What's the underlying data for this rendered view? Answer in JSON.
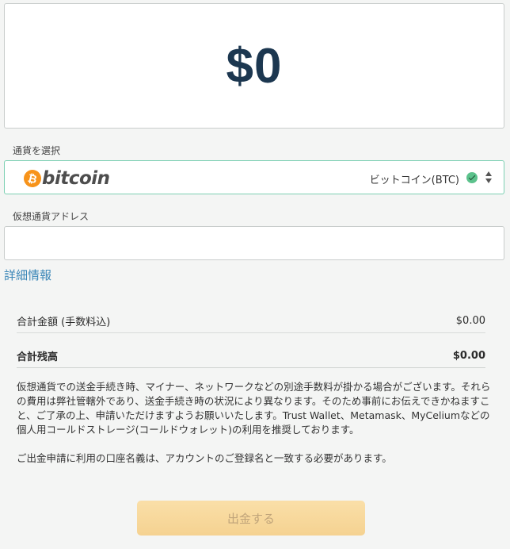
{
  "amount": {
    "value": "$0"
  },
  "currency": {
    "label": "通貨を選択",
    "logo_symbol": "₿",
    "logo_text": "bitcoin",
    "selected_name": "ビットコイン(BTC)"
  },
  "address": {
    "label": "仮想通貨アドレス",
    "value": ""
  },
  "details_link": "詳細情報",
  "summary": {
    "total_fee_label": "合計金額 (手数料込)",
    "total_fee_value": "$0.00",
    "balance_label": "合計残高",
    "balance_value": "$0.00"
  },
  "notice": {
    "paragraph1": "仮想通貨での送金手続き時、マイナー、ネットワークなどの別途手数料が掛かる場合がございます。それらの費用は弊社管轄外であり、送金手続き時の状況により異なります。そのため事前にお伝えできかねますこと、ご了承の上、申請いただけますようお願いいたします。Trust Wallet、Metamask、MyCeliumなどの個人用コールドストレージ(コールドウォレット)の利用を推奨しております。",
    "paragraph2": "ご出金申請に利用の口座名義は、アカウントのご登録名と一致する必要があります。"
  },
  "withdraw_button": "出金する",
  "colors": {
    "amount_text": "#1c3750",
    "select_border": "#7dd0b3",
    "link": "#3a86b7",
    "bitcoin_orange": "#f7931a",
    "check_green": "#5cc28c",
    "button_bg": "#f5d291"
  },
  "icons": [
    "bitcoin-logo-icon",
    "check-circle-icon",
    "sort-arrows-icon"
  ]
}
